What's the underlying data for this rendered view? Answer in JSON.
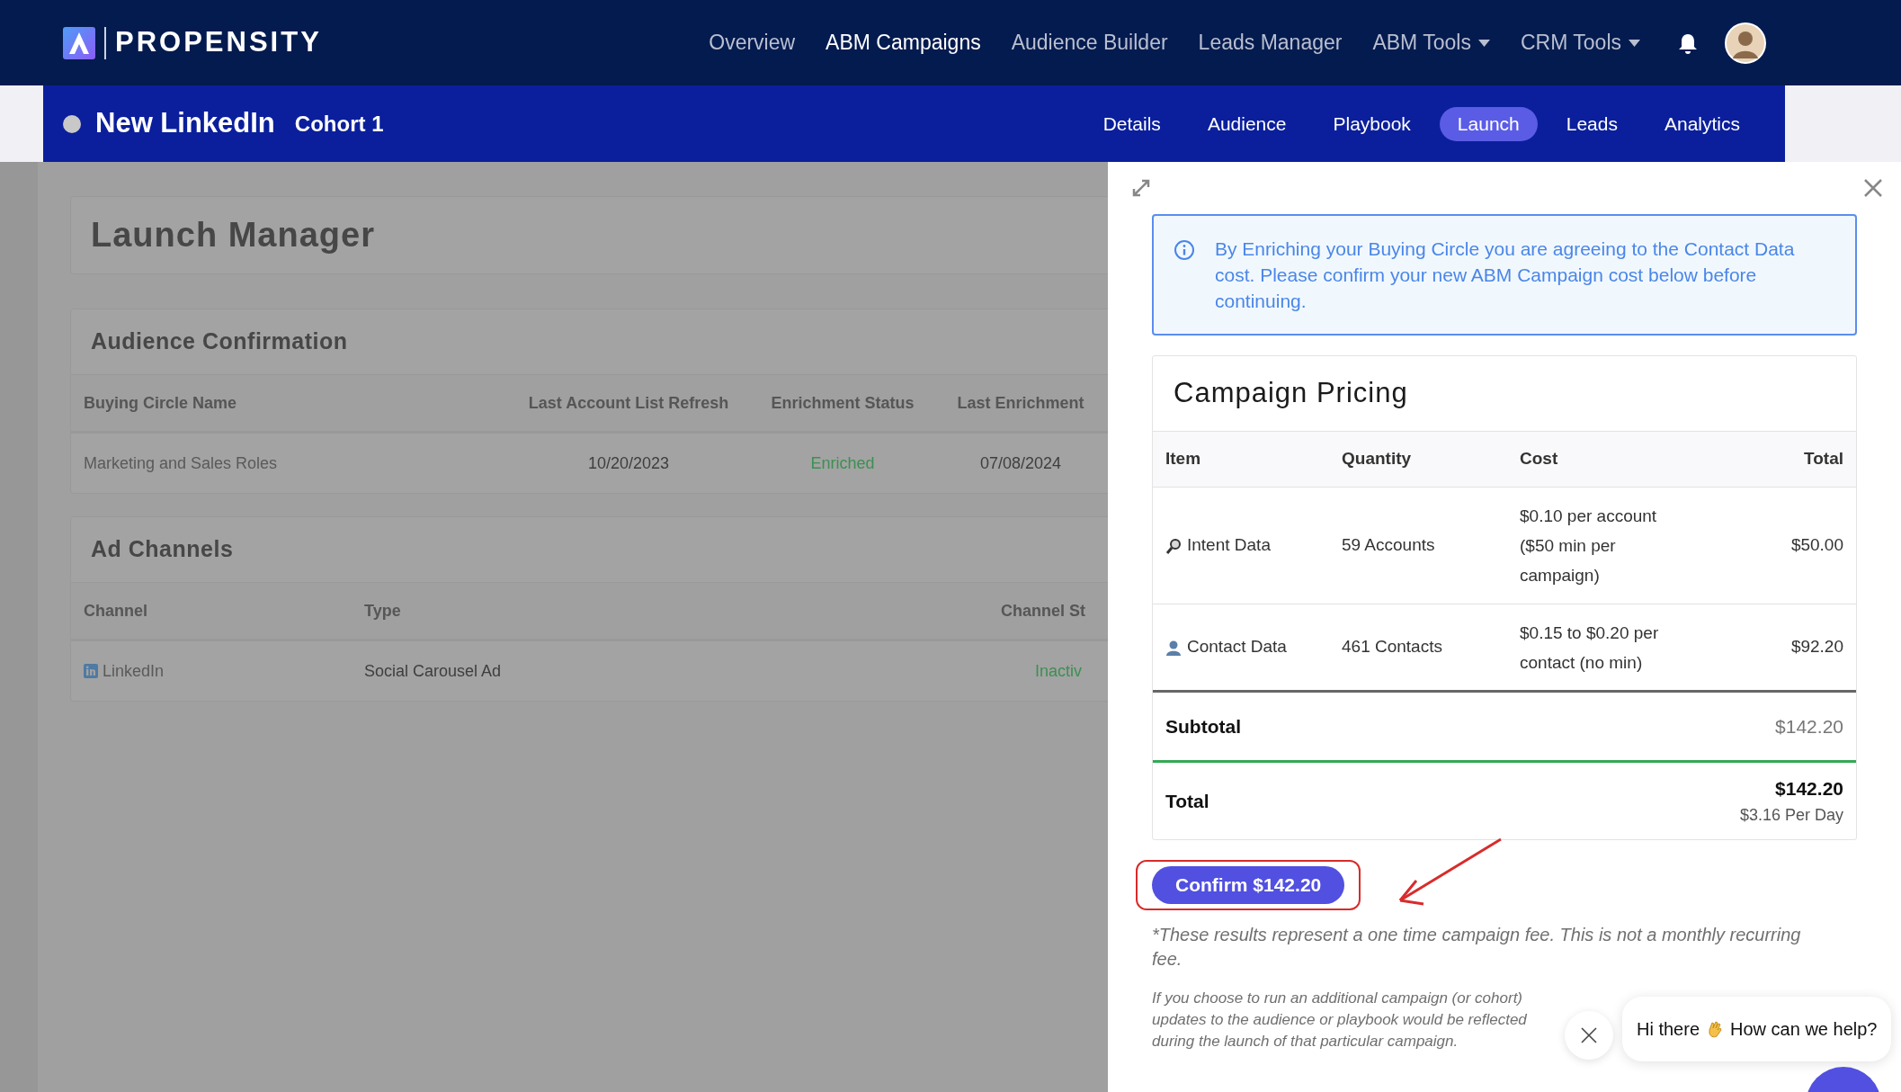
{
  "nav": {
    "brand": "PROPENSITY",
    "items": [
      {
        "label": "Overview",
        "selected": false,
        "dropdown": false
      },
      {
        "label": "ABM Campaigns",
        "selected": true,
        "dropdown": false
      },
      {
        "label": "Audience Builder",
        "selected": false,
        "dropdown": false
      },
      {
        "label": "Leads Manager",
        "selected": false,
        "dropdown": false
      },
      {
        "label": "ABM Tools",
        "selected": false,
        "dropdown": true
      },
      {
        "label": "CRM Tools",
        "selected": false,
        "dropdown": true
      }
    ]
  },
  "campaign": {
    "color": "#c8c8c8",
    "name": "New LinkedIn",
    "cohort": "Cohort 1",
    "tabs": [
      {
        "label": "Details",
        "selected": false
      },
      {
        "label": "Audience",
        "selected": false
      },
      {
        "label": "Playbook",
        "selected": false
      },
      {
        "label": "Launch",
        "selected": true
      },
      {
        "label": "Leads",
        "selected": false
      },
      {
        "label": "Analytics",
        "selected": false
      }
    ]
  },
  "launch_manager": {
    "title": "Launch Manager",
    "audience_confirmation": {
      "title": "Audience Confirmation",
      "columns": [
        "Buying Circle Name",
        "Last Account List Refresh",
        "Enrichment Status",
        "Last Enrichment"
      ],
      "rows": [
        {
          "cells": [
            {
              "text": "Marketing and Sales Roles",
              "kind": "name"
            },
            {
              "text": "10/20/2023",
              "kind": "date"
            },
            {
              "text": "Enriched",
              "kind": "status"
            },
            {
              "text": "07/08/2024",
              "kind": "date"
            }
          ]
        }
      ]
    },
    "ad_channels": {
      "title": "Ad Channels",
      "columns": [
        "Channel",
        "Type",
        "Channel St"
      ],
      "rows": [
        {
          "cells": [
            {
              "text": "LinkedIn",
              "kind": "channel"
            },
            {
              "text": "Social Carousel Ad",
              "kind": "type"
            },
            {
              "text": "Inactiv",
              "kind": "status"
            }
          ]
        }
      ]
    }
  },
  "drawer": {
    "notice": "By Enriching your Buying Circle you are agreeing to the Contact Data cost. Please confirm your new ABM Campaign cost below before continuing.",
    "pricing": {
      "title": "Campaign Pricing",
      "columns": [
        "Item",
        "Quantity",
        "Cost",
        "Total"
      ],
      "rows": [
        {
          "kind": "intent",
          "item": "Intent Data",
          "quantity": "59 Accounts",
          "cost": "$0.10 per account ($50 min per campaign)",
          "total": "$50.00"
        },
        {
          "kind": "contact",
          "item": "Contact Data",
          "quantity": "461 Contacts",
          "cost": "$0.15 to $0.20 per contact (no min)",
          "total": "$92.20"
        }
      ],
      "subtotal_label": "Subtotal",
      "subtotal": "$142.20",
      "total_label": "Total",
      "total": "$142.20",
      "per_day": "$3.16 Per Day"
    },
    "confirm_button": "Confirm $142.20",
    "footnote": "*These results represent a one time campaign fee. This is not a monthly recurring fee.",
    "note": "If you choose to run an additional campaign (or cohort) updates to the audience or playbook would be reflected during the launch of that particular campaign."
  },
  "chat": {
    "greeting": "Hi there",
    "question": "How can we help?"
  }
}
